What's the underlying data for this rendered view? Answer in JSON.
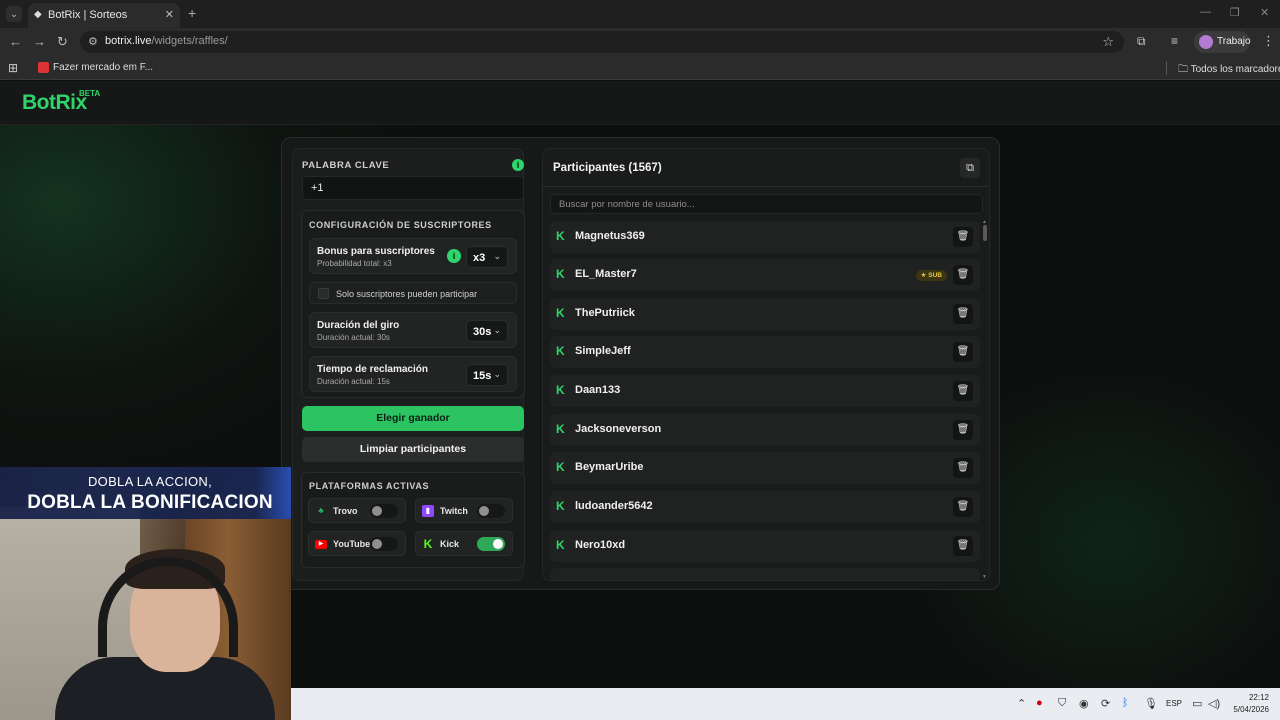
{
  "browser": {
    "tab_title": "BotRix | Sorteos",
    "url_host": "botrix.live",
    "url_path": "/widgets/raffles/",
    "profile_label": "Trabajo",
    "bookmark_label": "Fazer mercado em F...",
    "all_bookmarks_label": "Todos los marcadores"
  },
  "app": {
    "logo": "BotRix",
    "logo_badge": "BETA"
  },
  "left": {
    "keyword_label": "PALABRA CLAVE",
    "keyword_value": "+1",
    "subs_title": "CONFIGURACIÓN DE SUSCRIPTORES",
    "bonus_title": "Bonus para suscriptores",
    "bonus_sub": "Probabilidad total: x3",
    "bonus_value": "x3",
    "subs_only_label": "Solo suscriptores pueden participar",
    "spin_title": "Duración del giro",
    "spin_sub": "Duración actual: 30s",
    "spin_value": "30s",
    "claim_title": "Tiempo de reclamación",
    "claim_sub": "Duración actual: 15s",
    "claim_value": "15s",
    "pick_winner": "Elegir ganador",
    "clear_participants": "Limpiar participantes",
    "platforms_title": "PLATAFORMAS ACTIVAS",
    "platforms": [
      {
        "name": "Trovo",
        "enabled": false,
        "color": "#1dbf73"
      },
      {
        "name": "Twitch",
        "enabled": false,
        "color": "#9146ff"
      },
      {
        "name": "YouTube",
        "enabled": false,
        "color": "#ff0000"
      },
      {
        "name": "Kick",
        "enabled": true,
        "color": "#53fc18"
      }
    ]
  },
  "right": {
    "participants_title": "Participantes (1567)",
    "search_placeholder": "Buscar por nombre de usuario...",
    "participants": [
      {
        "name": "Magnetus369",
        "sub": false
      },
      {
        "name": "EL_Master7",
        "sub": true,
        "badge": "SUB"
      },
      {
        "name": "ThePutriick",
        "sub": false
      },
      {
        "name": "SimpleJeff",
        "sub": false
      },
      {
        "name": "Daan133",
        "sub": false
      },
      {
        "name": "Jacksoneverson",
        "sub": false
      },
      {
        "name": "BeymarUribe",
        "sub": false
      },
      {
        "name": "ludoander5642",
        "sub": false
      },
      {
        "name": "Nero10xd",
        "sub": false
      }
    ]
  },
  "overlay": {
    "line1": "DOBLA LA ACCION,",
    "line2": "DOBLA LA BONIFICACION"
  },
  "taskbar": {
    "lang": "ESP",
    "time": "22:12",
    "date": "5/04/2026"
  },
  "colors": {
    "accent": "#2fd46b",
    "sub_badge": "#e8c840"
  }
}
